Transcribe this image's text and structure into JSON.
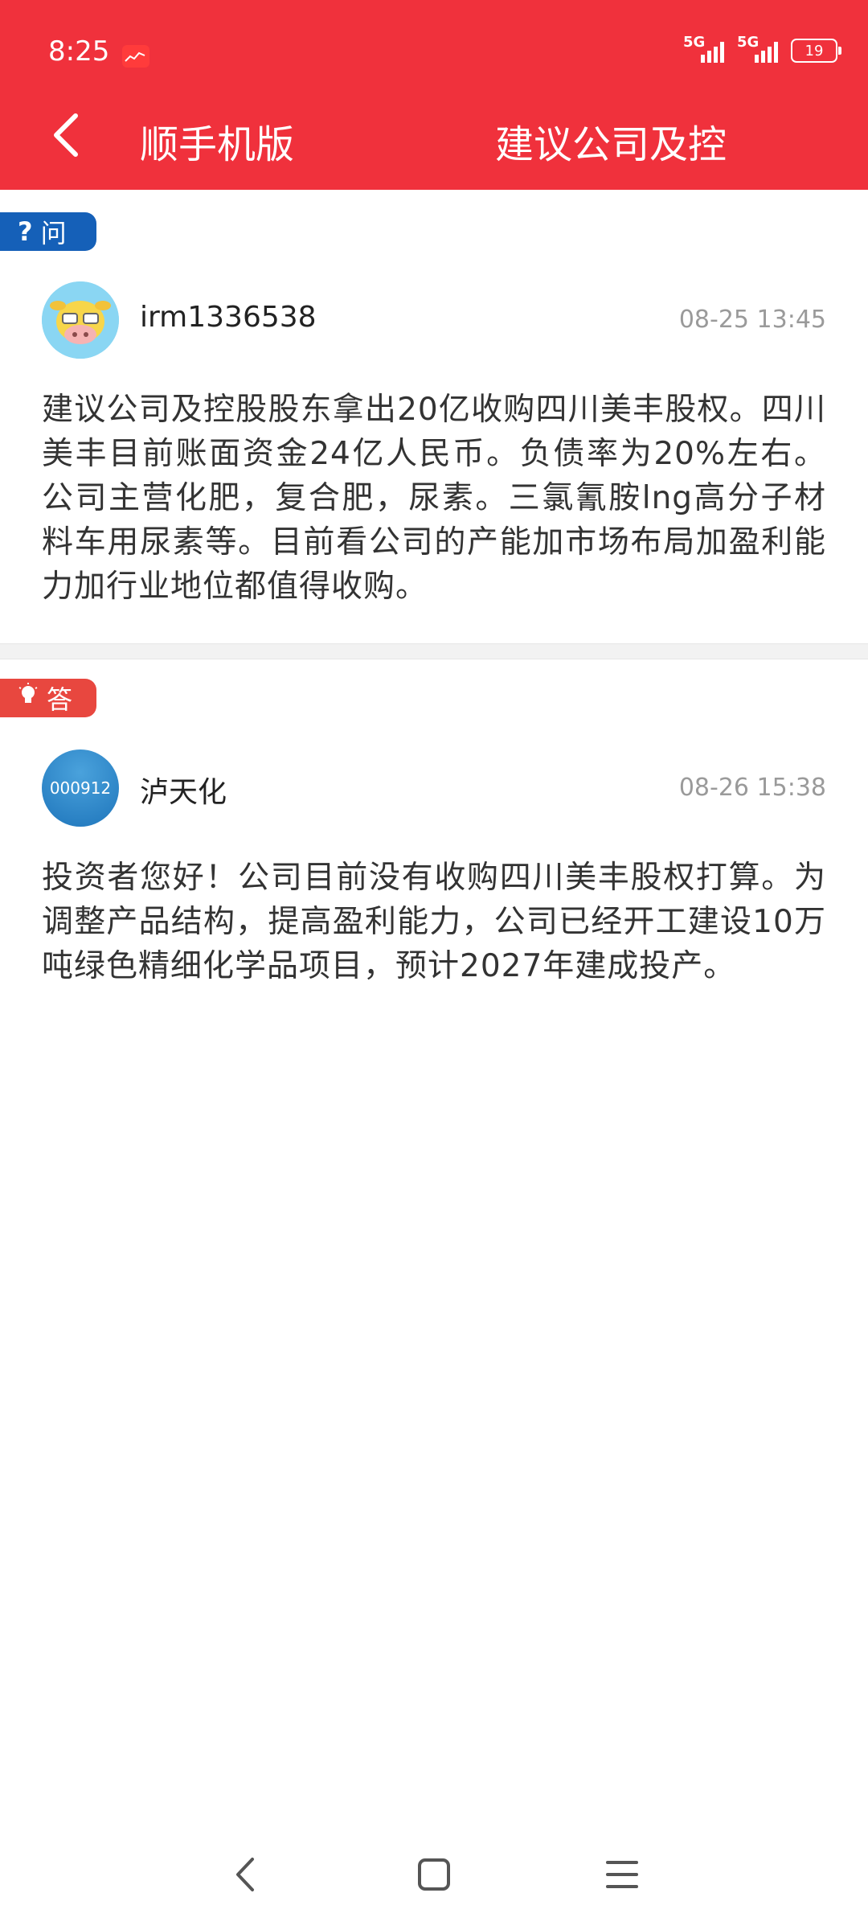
{
  "status_bar": {
    "time": "8:25",
    "network1": "5G",
    "network2": "5G",
    "battery": "19"
  },
  "header": {
    "nav_title": "顺手机版",
    "page_title": "建议公司及控"
  },
  "question": {
    "badge_label": "问",
    "badge_glyph": "?",
    "username": "irm1336538",
    "timestamp": "08-25 13:45",
    "text": "建议公司及控股股东拿出20亿收购四川美丰股权。四川美丰目前账面资金24亿人民币。负债率为20%左右。公司主营化肥，复合肥，尿素。三氯氰胺lng高分子材料车用尿素等。目前看公司的产能加市场布局加盈利能力加行业地位都值得收购。"
  },
  "answer": {
    "badge_label": "答",
    "username": "泸天化",
    "avatar_text": "000912",
    "timestamp": "08-26 15:38",
    "text": "投资者您好！公司目前没有收购四川美丰股权打算。为调整产品结构，提高盈利能力，公司已经开工建设10万吨绿色精细化学品项目，预计2027年建成投产。"
  },
  "colors": {
    "header_bg": "#f0313c",
    "question_badge": "#1560b8",
    "answer_badge": "#e8473f"
  }
}
